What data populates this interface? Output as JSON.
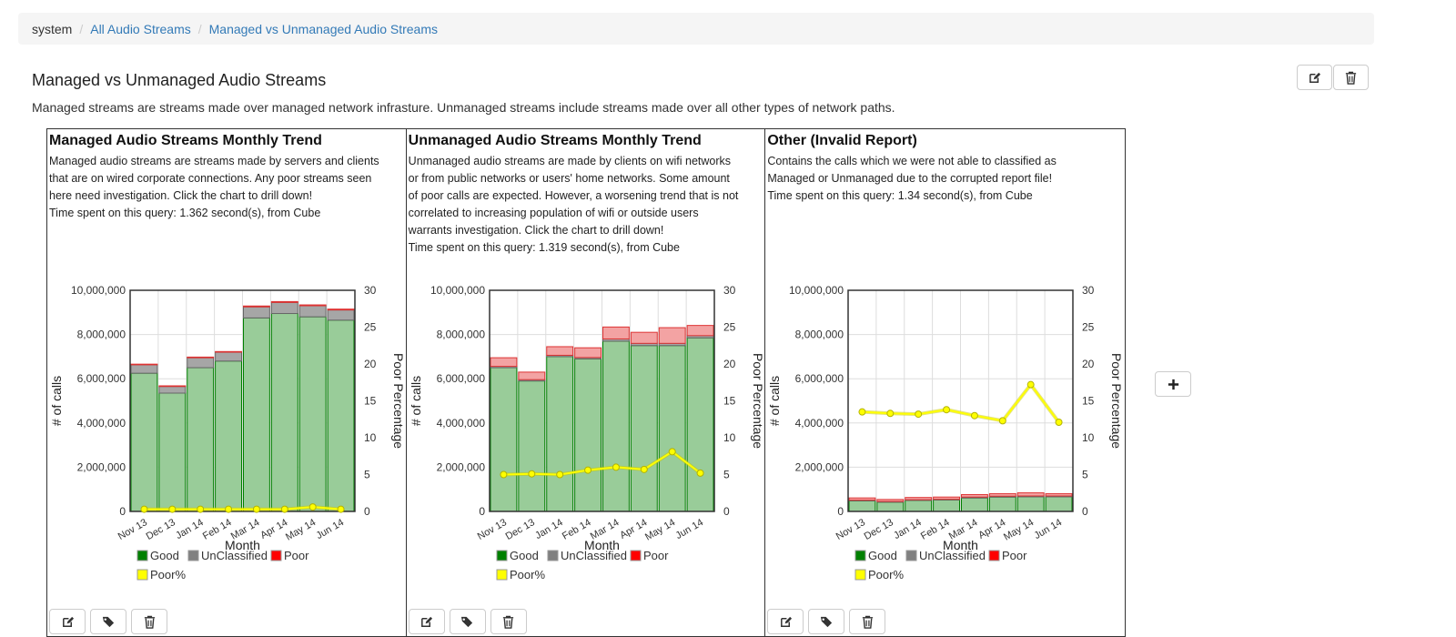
{
  "breadcrumb": {
    "root": "system",
    "link1": "All Audio Streams",
    "link2": "Managed vs Unmanaged Audio Streams",
    "separator": "/"
  },
  "page": {
    "title": "Managed vs Unmanaged Audio Streams",
    "description": "Managed streams are streams made over managed network infrasture. Unmanaged streams include streams made over all other types of network paths."
  },
  "icons": {
    "edit": "edit-icon",
    "trash": "trash-icon",
    "tags": "tags-icon",
    "plus": "plus-icon"
  },
  "colors": {
    "link": "#337ab7",
    "good": "#008000",
    "unclassified": "#808080",
    "poor": "#ff0000",
    "poor_pct": "#ffff00"
  },
  "panels": [
    {
      "title": "Managed Audio Streams Monthly Trend",
      "desc_lines": [
        "Managed audio streams are streams made by servers and clients",
        "that are on wired corporate connections. Any poor streams seen",
        "here need investigation. Click the chart to drill down!",
        "Time spent on this query: 1.362 second(s), from Cube"
      ]
    },
    {
      "title": "Unmanaged Audio Streams Monthly Trend",
      "desc_lines": [
        "Unmanaged audio streams are made by clients on wifi networks",
        "or from public networks or users' home networks. Some amount",
        "of poor calls are expected. However, a worsening trend that is not",
        "correlated to increasing population of wifi or outside users",
        "warrants investigation. Click the chart to drill down!",
        "Time spent on this query: 1.319 second(s), from Cube"
      ]
    },
    {
      "title": "Other (Invalid Report)",
      "desc_lines": [
        "Contains the calls which we were not able to classified as",
        "Managed or Unmanaged due to the corrupted report file!",
        "Time spent on this query: 1.34 second(s), from Cube"
      ]
    }
  ],
  "chart_data": [
    {
      "type": "bar",
      "stacked": true,
      "categories": [
        "Nov 13",
        "Dec 13",
        "Jan 14",
        "Feb 14",
        "Mar 14",
        "Apr 14",
        "May 14",
        "Jun 14"
      ],
      "xlabel": "Month",
      "ylabel": "# of calls",
      "y2label": "Poor Percentage",
      "ylim": [
        0,
        10000000
      ],
      "y2lim": [
        0,
        30
      ],
      "yticks": [
        "0",
        "2,000,000",
        "4,000,000",
        "6,000,000",
        "8,000,000",
        "10,000,000"
      ],
      "y2ticks": [
        "0",
        "5",
        "10",
        "15",
        "20",
        "25",
        "30"
      ],
      "grid": true,
      "legend": [
        "Good",
        "UnClassified",
        "Poor",
        "Poor%"
      ],
      "series": [
        {
          "name": "Good",
          "values": [
            6250000,
            5350000,
            6500000,
            6800000,
            8750000,
            8950000,
            8800000,
            8650000
          ]
        },
        {
          "name": "UnClassified",
          "values": [
            380000,
            300000,
            450000,
            400000,
            500000,
            500000,
            500000,
            460000
          ]
        },
        {
          "name": "Poor",
          "values": [
            30000,
            30000,
            30000,
            30000,
            40000,
            40000,
            40000,
            40000
          ]
        },
        {
          "name": "Poor%",
          "values": [
            0.3,
            0.3,
            0.3,
            0.3,
            0.3,
            0.3,
            0.6,
            0.3
          ]
        }
      ]
    },
    {
      "type": "bar",
      "stacked": true,
      "categories": [
        "Nov 13",
        "Dec 13",
        "Jan 14",
        "Feb 14",
        "Mar 14",
        "Apr 14",
        "May 14",
        "Jun 14"
      ],
      "xlabel": "Month",
      "ylabel": "# of calls",
      "y2label": "Poor Percentage",
      "ylim": [
        0,
        10000000
      ],
      "y2lim": [
        0,
        30
      ],
      "yticks": [
        "0",
        "2,000,000",
        "4,000,000",
        "6,000,000",
        "8,000,000",
        "10,000,000"
      ],
      "y2ticks": [
        "0",
        "5",
        "10",
        "15",
        "20",
        "25",
        "30"
      ],
      "grid": true,
      "legend": [
        "Good",
        "UnClassified",
        "Poor",
        "Poor%"
      ],
      "series": [
        {
          "name": "Good",
          "values": [
            6500000,
            5900000,
            7000000,
            6900000,
            7700000,
            7500000,
            7500000,
            7850000
          ]
        },
        {
          "name": "UnClassified",
          "values": [
            60000,
            60000,
            60000,
            60000,
            100000,
            100000,
            100000,
            100000
          ]
        },
        {
          "name": "Poor",
          "values": [
            390000,
            340000,
            390000,
            440000,
            540000,
            500000,
            710000,
            460000
          ]
        },
        {
          "name": "Poor%",
          "values": [
            5.0,
            5.1,
            5.0,
            5.6,
            6.0,
            5.7,
            8.1,
            5.2
          ]
        }
      ]
    },
    {
      "type": "bar",
      "stacked": true,
      "categories": [
        "Nov 13",
        "Dec 13",
        "Jan 14",
        "Feb 14",
        "Mar 14",
        "Apr 14",
        "May 14",
        "Jun 14"
      ],
      "xlabel": "Month",
      "ylabel": "# of calls",
      "y2label": "Poor Percentage",
      "ylim": [
        0,
        10000000
      ],
      "y2lim": [
        0,
        30
      ],
      "yticks": [
        "0",
        "2,000,000",
        "4,000,000",
        "6,000,000",
        "8,000,000",
        "10,000,000"
      ],
      "y2ticks": [
        "0",
        "5",
        "10",
        "15",
        "20",
        "25",
        "30"
      ],
      "grid": true,
      "legend": [
        "Good",
        "UnClassified",
        "Poor",
        "Poor%"
      ],
      "series": [
        {
          "name": "Good",
          "values": [
            480000,
            420000,
            500000,
            520000,
            610000,
            650000,
            660000,
            660000
          ]
        },
        {
          "name": "UnClassified",
          "values": [
            30000,
            30000,
            30000,
            30000,
            40000,
            40000,
            40000,
            40000
          ]
        },
        {
          "name": "Poor",
          "values": [
            100000,
            90000,
            100000,
            100000,
            110000,
            110000,
            140000,
            100000
          ]
        },
        {
          "name": "Poor%",
          "values": [
            13.5,
            13.3,
            13.2,
            13.8,
            13.0,
            12.3,
            17.2,
            12.1
          ]
        }
      ]
    }
  ]
}
